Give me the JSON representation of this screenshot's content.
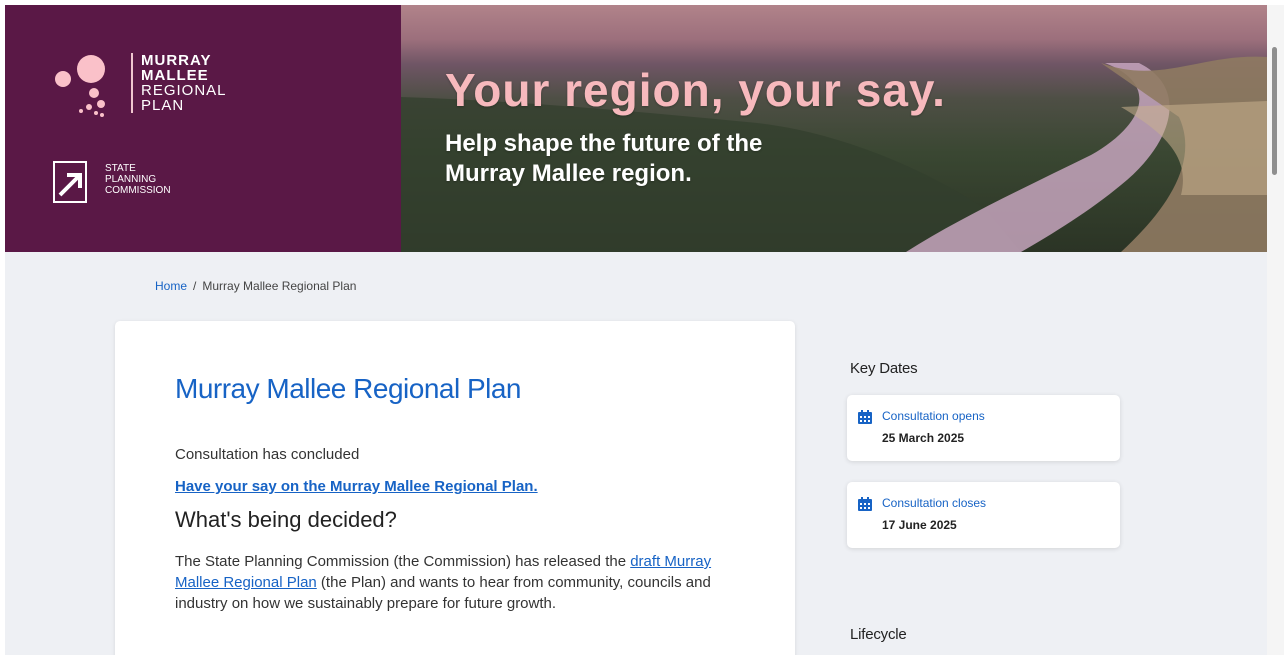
{
  "brand": {
    "logo_line1": "MURRAY",
    "logo_line2": "MALLEE",
    "logo_line3": "REGIONAL",
    "logo_line4": "PLAN",
    "commission_line1": "STATE",
    "commission_line2": "PLANNING",
    "commission_line3": "COMMISSION",
    "panel_color": "#5a1846"
  },
  "hero": {
    "title": "Your region, your say.",
    "subtitle_line1": "Help shape the future of the",
    "subtitle_line2": "Murray Mallee region."
  },
  "breadcrumb": {
    "home": "Home",
    "separator": "/",
    "current": "Murray Mallee Regional Plan"
  },
  "main": {
    "title": "Murray Mallee Regional Plan",
    "status": "Consultation has concluded",
    "say_link": "Have your say on the Murray Mallee Regional Plan.",
    "section_heading": "What's being decided?",
    "body_before_link": "The State Planning Commission (the Commission) has released the ",
    "body_link": "draft Murray Mallee Regional Plan",
    "body_after_link": " (the Plan) and wants to hear from community, councils and industry on how we sustainably prepare for future growth."
  },
  "sidebar": {
    "key_dates_title": "Key Dates",
    "dates": [
      {
        "label": "Consultation opens",
        "value": "25 March 2025",
        "icon": "calendar-icon"
      },
      {
        "label": "Consultation closes",
        "value": "17 June 2025",
        "icon": "calendar-icon"
      }
    ],
    "lifecycle_title": "Lifecycle"
  },
  "colors": {
    "accent": "#1763c5",
    "hero_title": "#f7b9bd",
    "page_bg": "#eef0f4"
  }
}
